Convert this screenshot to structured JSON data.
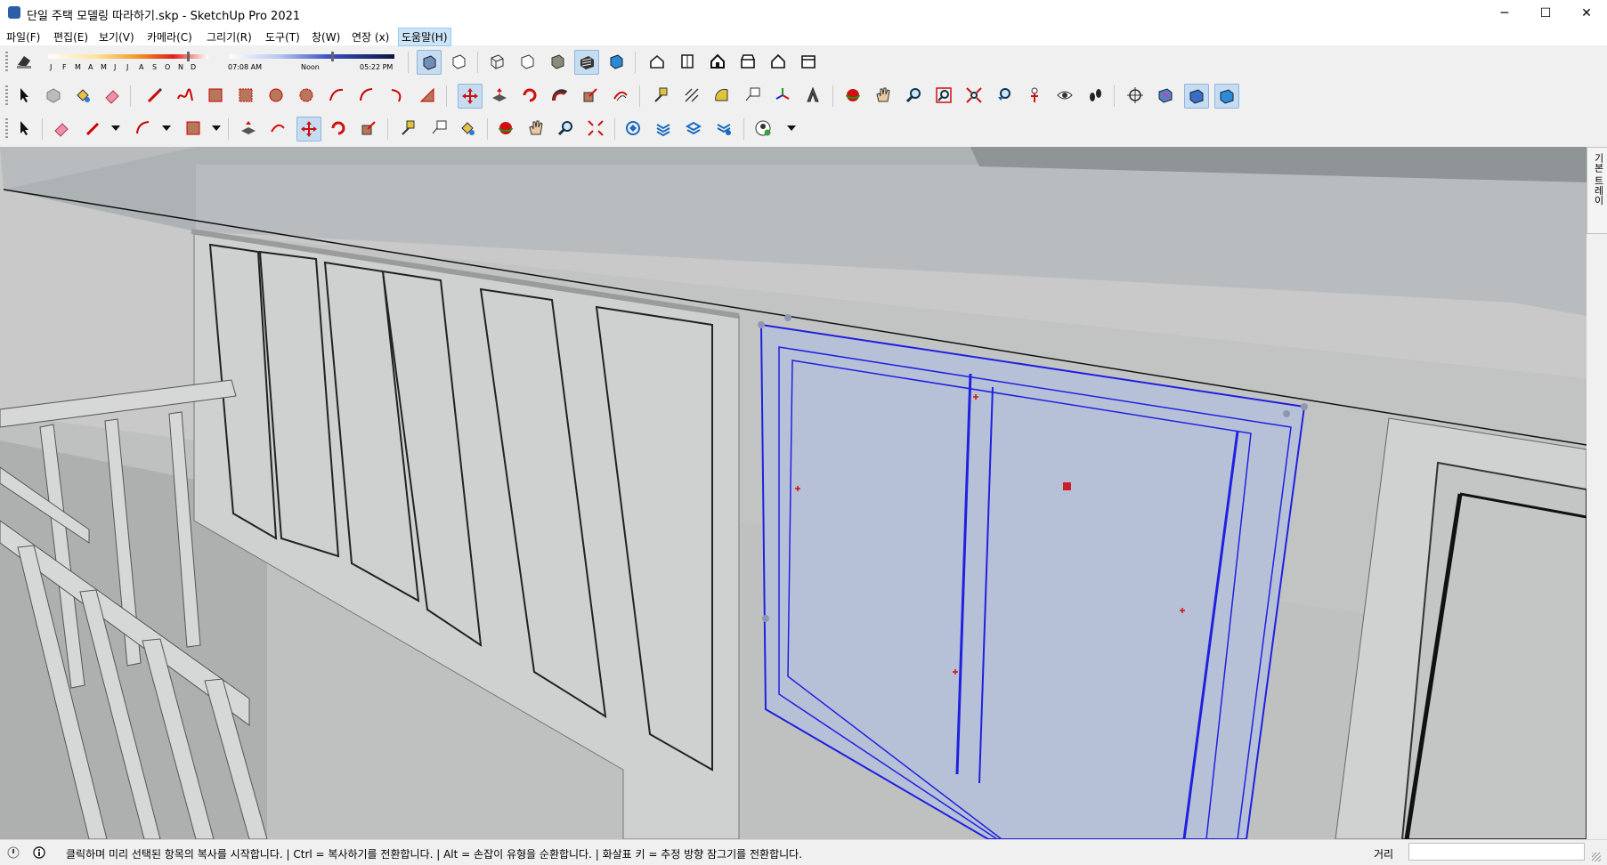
{
  "window": {
    "title": "단일 주택 모델링 따라하기.skp - SketchUp Pro 2021",
    "minimize": "─",
    "maximize": "☐",
    "close": "✕"
  },
  "menu": [
    "파일(F)",
    "편집(E)",
    "보기(V)",
    "카메라(C)",
    "그리기(R)",
    "도구(T)",
    "창(W)",
    "연장 (x)",
    "도움말(H)"
  ],
  "shadows": {
    "months": [
      "J",
      "F",
      "M",
      "A",
      "M",
      "J",
      "J",
      "A",
      "S",
      "O",
      "N",
      "D"
    ],
    "time_start": "07:08 AM",
    "time_mid": "Noon",
    "time_end": "05:22 PM"
  },
  "tray_label": "기본 트레이",
  "status": {
    "message": "클릭하며 미리 선택된 항목의 복사를 시작합니다. | Ctrl = 복사하기를 전환합니다. | Alt = 손잡이 유형을 순환합니다. | 화살표 키 = 추정 방향 잠그기를 전환합니다.",
    "measurement_label": "거리",
    "measurement_value": ""
  },
  "colors": {
    "selection": "#2020e0",
    "glass": "#b9c6dd",
    "toolbar_active": "#c6dcf0"
  }
}
